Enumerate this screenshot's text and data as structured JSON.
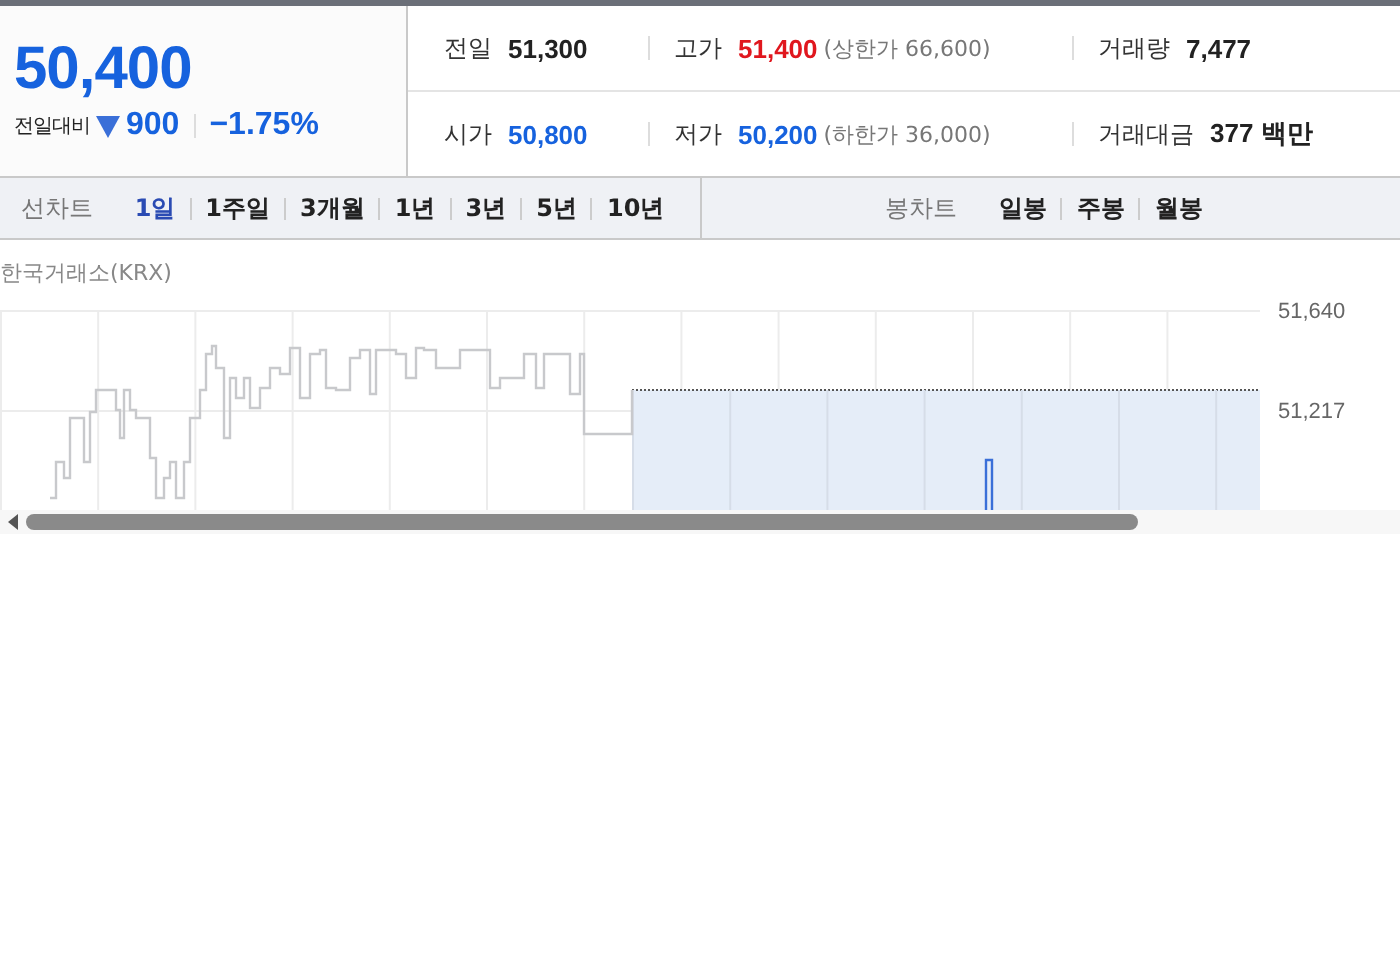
{
  "price": {
    "current": "50,400",
    "change_label": "전일대비",
    "change": "900",
    "falling": true,
    "rate": "−1.75%"
  },
  "stats": [
    [
      {
        "label": "전일",
        "value": "51,300",
        "color": "#222222"
      },
      {
        "label": "고가",
        "value": "51,400",
        "color": "#e0171e",
        "note": "(상한가 66,600)"
      },
      {
        "label": "거래량",
        "value": "7,477",
        "color": "#222222"
      }
    ],
    [
      {
        "label": "시가",
        "value": "50,800",
        "color": "#1662de"
      },
      {
        "label": "저가",
        "value": "50,200",
        "color": "#1662de",
        "note": "(하한가 36,000)"
      },
      {
        "label": "거래대금",
        "value": "377 백만",
        "color": "#222222"
      }
    ]
  ],
  "line_chart_tabs": {
    "title": "선차트",
    "items": [
      {
        "label": "1일",
        "selected": true
      },
      {
        "label": "1주일",
        "selected": false
      },
      {
        "label": "3개월",
        "selected": false
      },
      {
        "label": "1년",
        "selected": false
      },
      {
        "label": "3년",
        "selected": false
      },
      {
        "label": "5년",
        "selected": false
      },
      {
        "label": "10년",
        "selected": false
      }
    ]
  },
  "candle_chart_tabs": {
    "title": "봉차트",
    "items": [
      {
        "label": "일봉",
        "selected": false
      },
      {
        "label": "주봉",
        "selected": false
      },
      {
        "label": "월봉",
        "selected": false
      }
    ]
  },
  "chart": {
    "source": "한국거래소(KRX)",
    "y_axis_labels": [
      "51,640",
      "51,217"
    ]
  }
}
